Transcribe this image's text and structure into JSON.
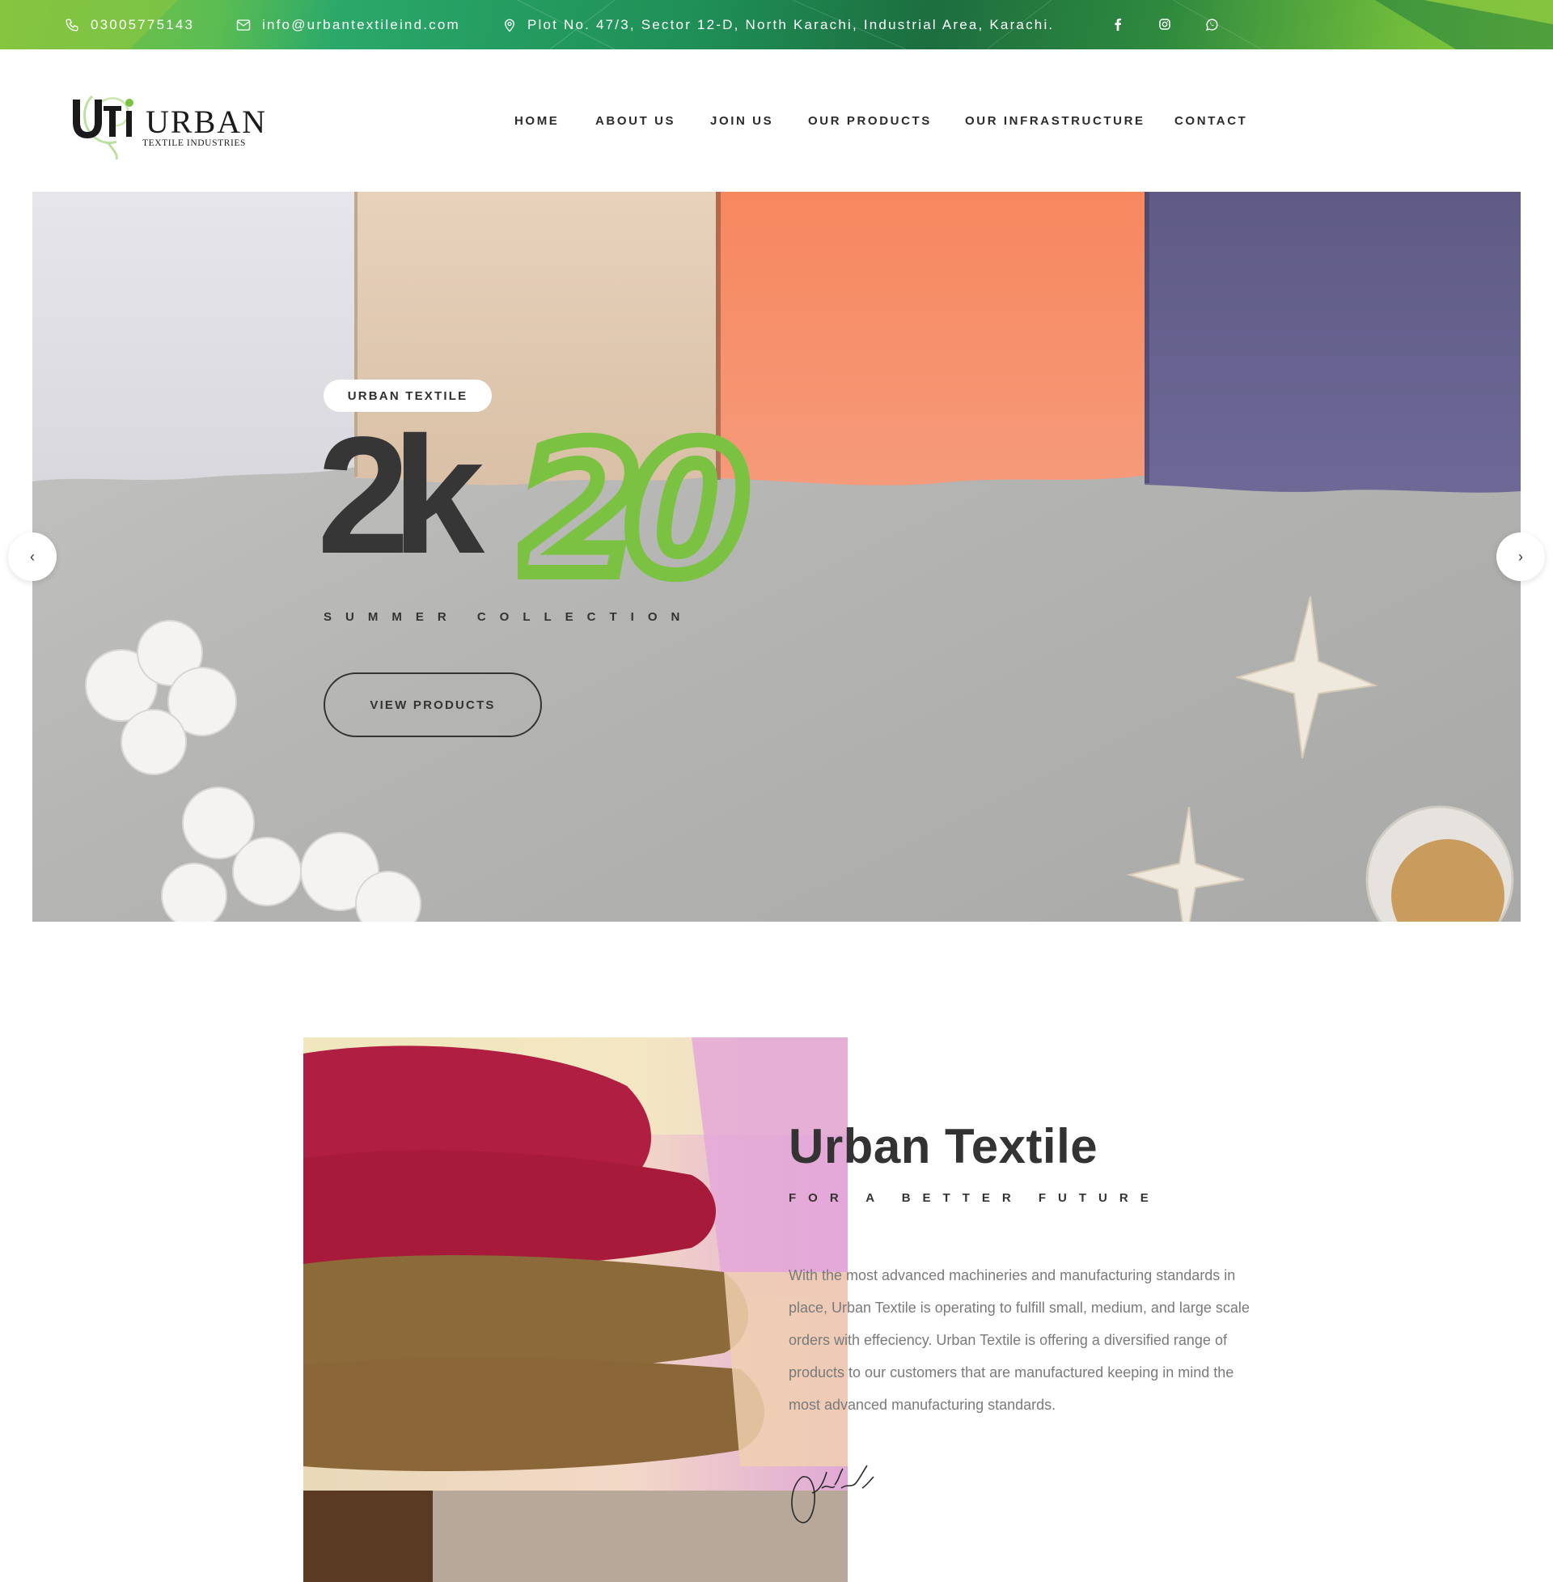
{
  "topbar": {
    "phone": "03005775143",
    "email": "info@urbantextileind.com",
    "address": "Plot No. 47/3, Sector 12-D, North Karachi, Industrial Area, Karachi.",
    "phone_icon": "phone-icon",
    "email_icon": "envelope-icon",
    "address_icon": "map-pin-icon",
    "social": [
      "facebook-icon",
      "instagram-icon",
      "whatsapp-icon"
    ]
  },
  "logo": {
    "mark": "Uti",
    "word": "URBAN",
    "sub": "TEXTILE INDUSTRIES"
  },
  "nav": {
    "items": [
      "HOME",
      "ABOUT US",
      "JOIN US",
      "OUR PRODUCTS",
      "OUR INFRASTRUCTURE",
      "CONTACT"
    ]
  },
  "hero": {
    "tag": "URBAN TEXTILE",
    "big_dark": "2k",
    "big_accent": "20",
    "subtitle": "SUMMER COLLECTION",
    "button": "VIEW PRODUCTS",
    "prev_arrow": "‹",
    "next_arrow": "›"
  },
  "about": {
    "title": "Urban Textile",
    "subtitle": "FOR A BETTER FUTURE",
    "body": "With the most advanced machineries and manufacturing standards in place, Urban Textile is operating to fulfill small, medium, and large scale orders with effeciency. Urban Textile is offering a diversified range of products to our customers that are manufactured keeping in mind the most advanced manufacturing standards.",
    "signature": "Otentic"
  },
  "colors": {
    "accent_green": "#7cc242",
    "dark_text": "#333333",
    "body_text": "#7a7a7a"
  }
}
